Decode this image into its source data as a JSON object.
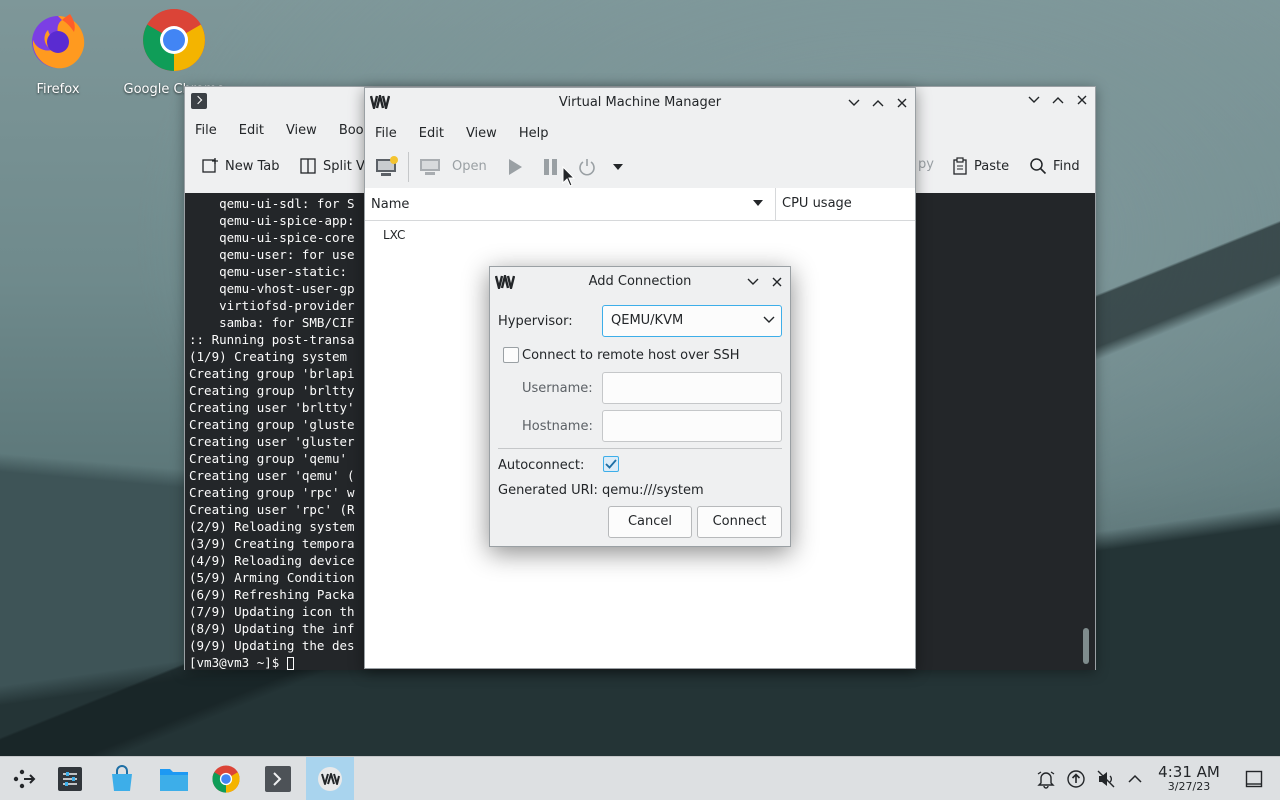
{
  "desktop": {
    "icons": [
      {
        "label": "Firefox",
        "icon": "firefox-icon"
      },
      {
        "label": "Google Chrome",
        "icon": "chrome-icon"
      }
    ]
  },
  "konsole": {
    "menu": [
      "File",
      "Edit",
      "View",
      "Bookm"
    ],
    "toolbar": {
      "new_tab": "New Tab",
      "split_view": "Split Vi",
      "copy": "py",
      "paste": "Paste",
      "find": "Find"
    },
    "terminal_lines": [
      "    qemu-ui-sdl: for S",
      "    qemu-ui-spice-app:",
      "    qemu-ui-spice-core",
      "    qemu-user: for use",
      "    qemu-user-static: ",
      "    qemu-vhost-user-gp",
      "    virtiofsd-provider",
      "    samba: for SMB/CIF",
      ":: Running post-transa",
      "(1/9) Creating system ",
      "Creating group 'brlapi",
      "Creating group 'brltty",
      "Creating user 'brltty'",
      "Creating group 'gluste",
      "Creating user 'gluster",
      "Creating group 'qemu' ",
      "Creating user 'qemu' (",
      "Creating group 'rpc' w",
      "Creating user 'rpc' (R",
      "(2/9) Reloading system",
      "(3/9) Creating tempora",
      "(4/9) Reloading device",
      "(5/9) Arming Condition",
      "(6/9) Refreshing Packa",
      "(7/9) Updating icon th",
      "(8/9) Updating the inf",
      "(9/9) Updating the des"
    ],
    "prompt": "[vm3@vm3 ~]$ "
  },
  "vmm": {
    "title": "Virtual Machine Manager",
    "menu": [
      "File",
      "Edit",
      "View",
      "Help"
    ],
    "toolbar": {
      "open": "Open"
    },
    "columns": {
      "name": "Name",
      "cpu": "CPU usage"
    },
    "rows": [
      "LXC"
    ]
  },
  "dialog": {
    "title": "Add Connection",
    "hypervisor_label": "Hypervisor:",
    "hypervisor_value": "QEMU/KVM",
    "ssh_label": "Connect to remote host over SSH",
    "ssh_checked": false,
    "username_label": "Username:",
    "username_value": "",
    "hostname_label": "Hostname:",
    "hostname_value": "",
    "autoconnect_label": "Autoconnect:",
    "autoconnect_checked": true,
    "uri_label": "Generated URI:",
    "uri_value": "qemu:///system",
    "cancel": "Cancel",
    "connect": "Connect"
  },
  "taskbar": {
    "time": "4:31 AM",
    "date": "3/27/23"
  },
  "colors": {
    "accent": "#3daee9",
    "terminal_bg": "#232629",
    "taskbar_active": "#a9d4ee"
  }
}
